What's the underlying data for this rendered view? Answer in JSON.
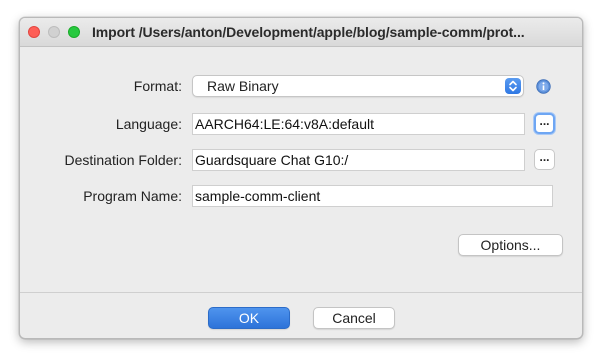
{
  "window": {
    "title": "Import /Users/anton/Development/apple/blog/sample-comm/prot..."
  },
  "form": {
    "format": {
      "label": "Format:",
      "value": "Raw Binary"
    },
    "language": {
      "label": "Language:",
      "value": "AARCH64:LE:64:v8A:default",
      "browse_label": "..."
    },
    "destination": {
      "label": "Destination Folder:",
      "value": "Guardsquare Chat G10:/",
      "browse_label": "..."
    },
    "program_name": {
      "label": "Program Name:",
      "value": "sample-comm-client"
    },
    "options_label": "Options..."
  },
  "footer": {
    "ok_label": "OK",
    "cancel_label": "Cancel"
  },
  "colors": {
    "accent": "#2f78e4",
    "close_light": "#fe5f57",
    "zoom_light": "#27c93f"
  }
}
